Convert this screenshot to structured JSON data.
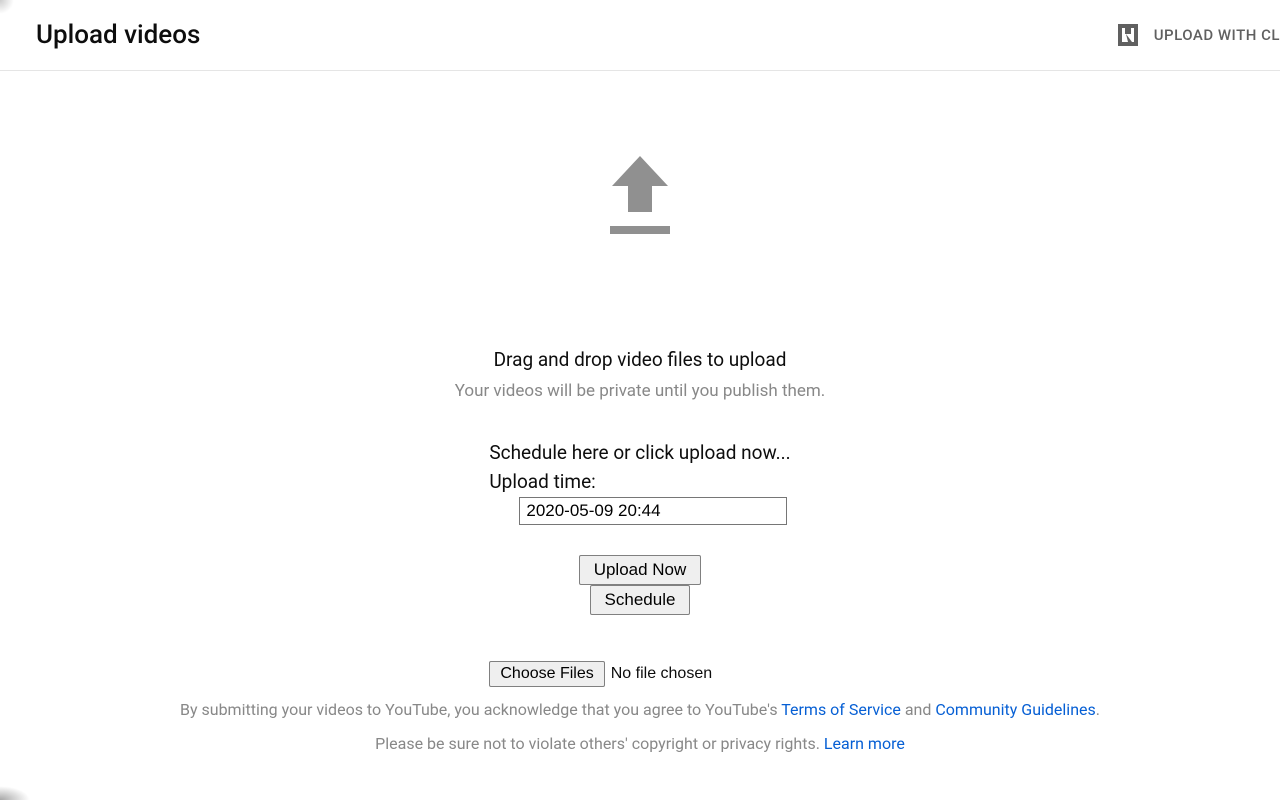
{
  "header": {
    "title": "Upload videos",
    "upload_with_text": "UPLOAD WITH CL"
  },
  "main": {
    "drag_text": "Drag and drop video files to upload",
    "privacy_text": "Your videos will be private until you publish them.",
    "schedule_prompt": "Schedule here or click upload now...",
    "upload_time_label": "Upload time:",
    "datetime_value": "2020-05-09 20:44",
    "upload_now_btn": "Upload Now",
    "schedule_btn": "Schedule",
    "choose_files_btn": "Choose Files",
    "no_file_text": "No file chosen"
  },
  "disclaimer": {
    "line1_prefix": "By submitting your videos to YouTube, you acknowledge that you agree to YouTube's ",
    "terms_link": "Terms of Service",
    "and_text": " and ",
    "community_link": "Community Guidelines",
    "line1_suffix": ".",
    "line2_prefix": "Please be sure not to violate others' copyright or privacy rights. ",
    "learn_more_link": "Learn more"
  }
}
